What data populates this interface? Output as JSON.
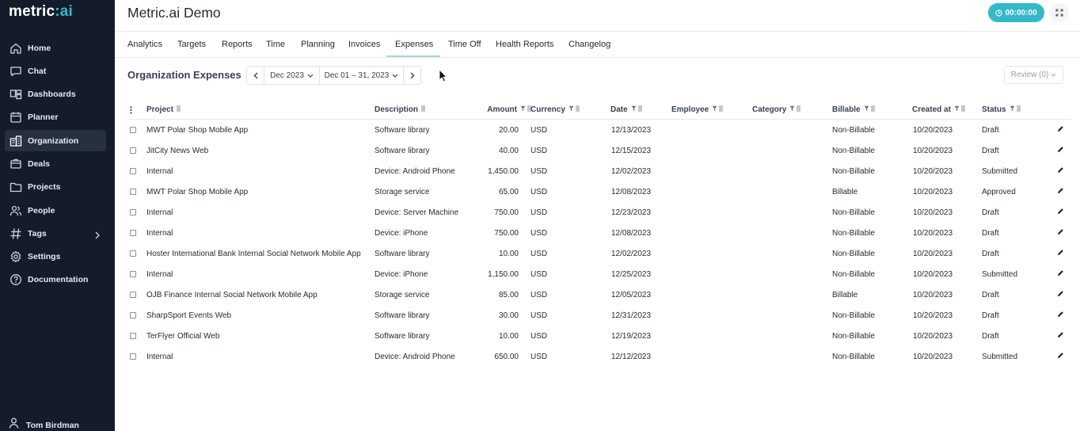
{
  "app": {
    "logo_main": "metric",
    "logo_accent": ":ai"
  },
  "sidebar": {
    "items": [
      {
        "label": "Home",
        "icon": "home-icon"
      },
      {
        "label": "Chat",
        "icon": "chat-icon"
      },
      {
        "label": "Dashboards",
        "icon": "dashboards-icon"
      },
      {
        "label": "Planner",
        "icon": "planner-icon"
      },
      {
        "label": "Organization",
        "icon": "organization-icon",
        "active": true
      },
      {
        "label": "Deals",
        "icon": "deals-icon"
      },
      {
        "label": "Projects",
        "icon": "projects-icon"
      },
      {
        "label": "People",
        "icon": "people-icon"
      },
      {
        "label": "Tags",
        "icon": "tags-icon",
        "has_submenu": true
      },
      {
        "label": "Settings",
        "icon": "settings-icon"
      },
      {
        "label": "Documentation",
        "icon": "documentation-icon"
      }
    ],
    "user": "Tom Birdman"
  },
  "header": {
    "title": "Metric.ai Demo",
    "timer": "00:00:00"
  },
  "tabs": [
    {
      "label": "Analytics"
    },
    {
      "label": "Targets"
    },
    {
      "label": "Reports"
    },
    {
      "label": "Time"
    },
    {
      "label": "Planning"
    },
    {
      "label": "Invoices"
    },
    {
      "label": "Expenses",
      "active": true
    },
    {
      "label": "Time Off"
    },
    {
      "label": "Health Reports"
    },
    {
      "label": "Changelog"
    }
  ],
  "expenses": {
    "title": "Organization Expenses",
    "month": "Dec 2023",
    "range": "Dec 01 – 31, 2023",
    "review": "Review (0)",
    "columns": {
      "project": "Project",
      "description": "Description",
      "amount": "Amount",
      "currency": "Currency",
      "date": "Date",
      "employee": "Employee",
      "category": "Category",
      "billable": "Billable",
      "created": "Created at",
      "status": "Status"
    },
    "rows": [
      {
        "project": "MWT Polar Shop Mobile App",
        "description": "Software library",
        "amount": "20.00",
        "currency": "USD",
        "date": "12/13/2023",
        "employee": "",
        "category": "",
        "billable": "Non-Billable",
        "created": "10/20/2023",
        "status": "Draft"
      },
      {
        "project": "JitCity News Web",
        "description": "Software library",
        "amount": "40.00",
        "currency": "USD",
        "date": "12/15/2023",
        "employee": "",
        "category": "",
        "billable": "Non-Billable",
        "created": "10/20/2023",
        "status": "Draft"
      },
      {
        "project": "Internal",
        "description": "Device: Android Phone",
        "amount": "1,450.00",
        "currency": "USD",
        "date": "12/02/2023",
        "employee": "",
        "category": "",
        "billable": "Non-Billable",
        "created": "10/20/2023",
        "status": "Submitted"
      },
      {
        "project": "MWT Polar Shop Mobile App",
        "description": "Storage service",
        "amount": "65.00",
        "currency": "USD",
        "date": "12/08/2023",
        "employee": "",
        "category": "",
        "billable": "Billable",
        "created": "10/20/2023",
        "status": "Approved"
      },
      {
        "project": "Internal",
        "description": "Device: Server Machine",
        "amount": "750.00",
        "currency": "USD",
        "date": "12/23/2023",
        "employee": "",
        "category": "",
        "billable": "Non-Billable",
        "created": "10/20/2023",
        "status": "Draft"
      },
      {
        "project": "Internal",
        "description": "Device: iPhone",
        "amount": "750.00",
        "currency": "USD",
        "date": "12/08/2023",
        "employee": "",
        "category": "",
        "billable": "Non-Billable",
        "created": "10/20/2023",
        "status": "Draft"
      },
      {
        "project": "Hoster International Bank Internal Social Network Mobile App",
        "description": "Software library",
        "amount": "10.00",
        "currency": "USD",
        "date": "12/02/2023",
        "employee": "",
        "category": "",
        "billable": "Non-Billable",
        "created": "10/20/2023",
        "status": "Draft"
      },
      {
        "project": "Internal",
        "description": "Device: iPhone",
        "amount": "1,150.00",
        "currency": "USD",
        "date": "12/25/2023",
        "employee": "",
        "category": "",
        "billable": "Non-Billable",
        "created": "10/20/2023",
        "status": "Submitted"
      },
      {
        "project": "OJB Finance Internal Social Network Mobile App",
        "description": "Storage service",
        "amount": "85.00",
        "currency": "USD",
        "date": "12/05/2023",
        "employee": "",
        "category": "",
        "billable": "Billable",
        "created": "10/20/2023",
        "status": "Draft"
      },
      {
        "project": "SharpSport Events Web",
        "description": "Software library",
        "amount": "30.00",
        "currency": "USD",
        "date": "12/31/2023",
        "employee": "",
        "category": "",
        "billable": "Non-Billable",
        "created": "10/20/2023",
        "status": "Draft"
      },
      {
        "project": "TerFlyer Official Web",
        "description": "Software library",
        "amount": "10.00",
        "currency": "USD",
        "date": "12/19/2023",
        "employee": "",
        "category": "",
        "billable": "Non-Billable",
        "created": "10/20/2023",
        "status": "Draft"
      },
      {
        "project": "Internal",
        "description": "Device: Android Phone",
        "amount": "650.00",
        "currency": "USD",
        "date": "12/12/2023",
        "employee": "",
        "category": "",
        "billable": "Non-Billable",
        "created": "10/20/2023",
        "status": "Submitted"
      }
    ]
  },
  "colors": {
    "sidebar_bg": "#141c2b",
    "accent": "#35b9c9"
  }
}
